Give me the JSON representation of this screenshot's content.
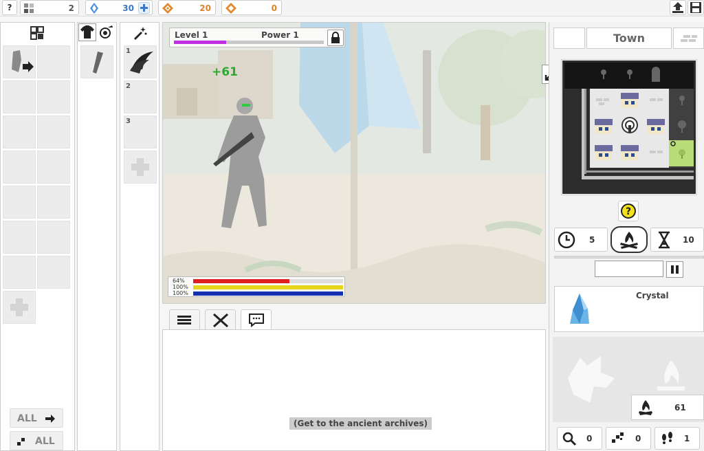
{
  "topbar": {
    "help": "?",
    "blocks": "2",
    "crystals": "30",
    "gold": "20",
    "essence": "0"
  },
  "panels": {
    "inv_all_move": "ALL",
    "inv_all_drop": "ALL",
    "spell_slots": [
      "1",
      "2",
      "3"
    ]
  },
  "battle": {
    "level": "Level 1",
    "power": "Power 1",
    "dmg": "+61",
    "bars": [
      "64%",
      "100%",
      "100%"
    ],
    "level_progress": 0.35
  },
  "bars_values": [
    0.64,
    1.0,
    1.0
  ],
  "log": {
    "hint": "(Get to the ancient archives)"
  },
  "right": {
    "location": "Town",
    "timer": "5",
    "wait": "10",
    "item_name": "Crystal",
    "fire_count": "61",
    "c_search": "0",
    "c_puzzle": "0",
    "c_steps": "1"
  },
  "colors": {
    "hp": "#e02020",
    "stamina": "#e7d51a",
    "mana": "#1430b0",
    "level_bar": "#c12fe0",
    "gold": "#d9822b",
    "crystal": "#3a78c5"
  }
}
